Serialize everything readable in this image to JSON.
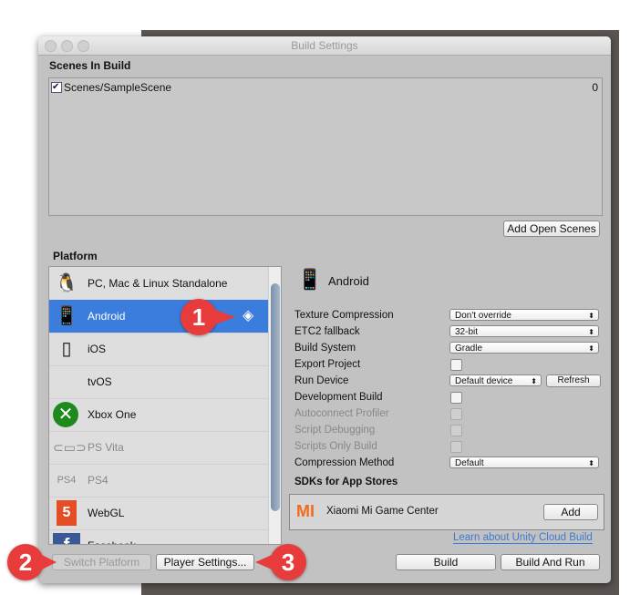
{
  "window": {
    "title": "Build Settings"
  },
  "scenes": {
    "heading": "Scenes In Build",
    "items": [
      {
        "name": "Scenes/SampleScene",
        "index": "0",
        "checked": true
      }
    ],
    "add_open_scenes": "Add Open Scenes"
  },
  "platform": {
    "heading": "Platform",
    "items": [
      {
        "label": "PC, Mac & Linux Standalone",
        "icon": "pc-mac-linux-icon"
      },
      {
        "label": "Android",
        "icon": "android-icon",
        "selected": true
      },
      {
        "label": "iOS",
        "icon": "ios-icon"
      },
      {
        "label": "tvOS",
        "icon": "apple-tv-icon"
      },
      {
        "label": "Xbox One",
        "icon": "xbox-icon"
      },
      {
        "label": "PS Vita",
        "icon": "ps-vita-icon"
      },
      {
        "label": "PS4",
        "icon": "ps4-icon"
      },
      {
        "label": "WebGL",
        "icon": "html5-icon"
      },
      {
        "label": "Facebook",
        "icon": "facebook-icon"
      }
    ]
  },
  "settings": {
    "title": "Android",
    "texture_compression": {
      "label": "Texture Compression",
      "value": "Don't override"
    },
    "etc2_fallback": {
      "label": "ETC2 fallback",
      "value": "32-bit"
    },
    "build_system": {
      "label": "Build System",
      "value": "Gradle"
    },
    "export_project": {
      "label": "Export Project"
    },
    "run_device": {
      "label": "Run Device",
      "value": "Default device",
      "refresh": "Refresh"
    },
    "development_build": {
      "label": "Development Build"
    },
    "autoconnect_profiler": {
      "label": "Autoconnect Profiler"
    },
    "script_debugging": {
      "label": "Script Debugging"
    },
    "scripts_only_build": {
      "label": "Scripts Only Build"
    },
    "compression_method": {
      "label": "Compression Method",
      "value": "Default"
    },
    "sdks_heading": "SDKs for App Stores",
    "sdk": {
      "name": "Xiaomi Mi Game Center",
      "add": "Add"
    },
    "cloud_link": "Learn about Unity Cloud Build"
  },
  "footer": {
    "switch_platform": "Switch Platform",
    "player_settings": "Player Settings...",
    "build": "Build",
    "build_and_run": "Build And Run"
  },
  "callouts": [
    "1",
    "2",
    "3"
  ],
  "colors": {
    "selection": "#3b7ddd",
    "callout": "#e83c3c",
    "link": "#3a7bd5",
    "xiaomi": "#f26b1d"
  }
}
